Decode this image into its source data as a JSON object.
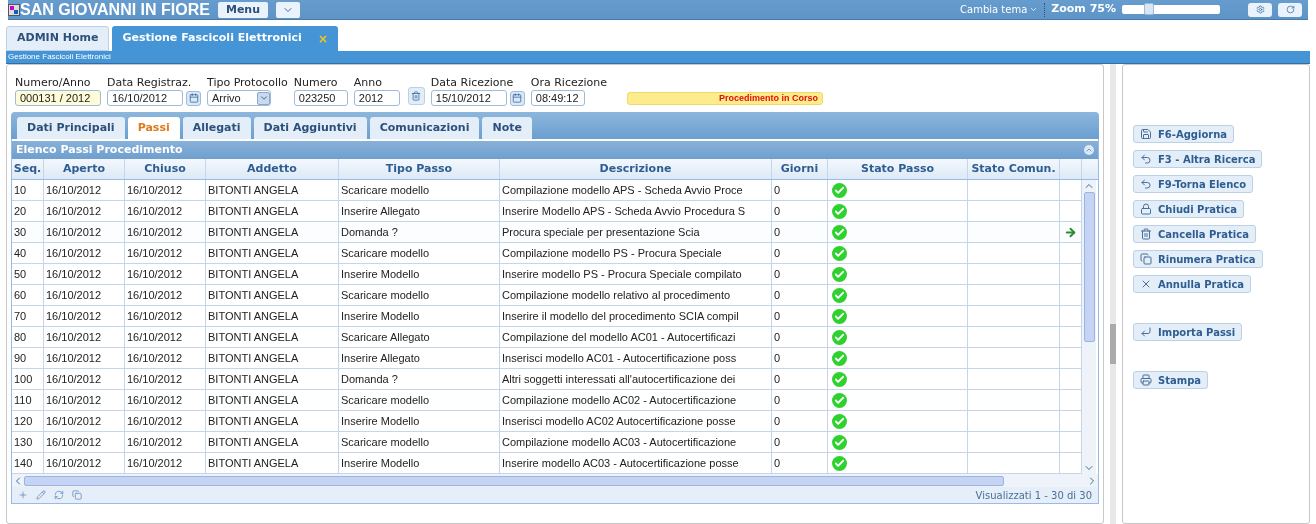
{
  "header": {
    "title": "SAN GIOVANNI IN FIORE",
    "menu_button": "Menu",
    "theme_menu": "Cambia tema",
    "zoom_label": "Zoom 75%",
    "zoom_slider": {
      "level": 0.28
    }
  },
  "main_tabs": [
    {
      "label": "ADMIN Home",
      "selected": false,
      "closable": false
    },
    {
      "label": "Gestione Fascicoli Elettronici",
      "selected": true,
      "closable": true,
      "close": "×"
    }
  ],
  "breadcrumb": "Gestione Fascicoli Elettronici",
  "fields": [
    {
      "label": "Numero/Anno",
      "value": "000131 / 2012",
      "kind": "highlight"
    },
    {
      "label": "Data Registraz.",
      "value": "16/10/2012",
      "kind": "date"
    },
    {
      "label": "Tipo Protocollo",
      "value": "Arrivo",
      "kind": "select"
    },
    {
      "label": "Numero",
      "value": "023250",
      "kind": "text"
    },
    {
      "label": "Anno",
      "value": "2012",
      "kind": "text-delete"
    },
    {
      "label": "Data Ricezione",
      "value": "15/10/2012",
      "kind": "date"
    },
    {
      "label": "Ora Ricezione",
      "value": "08:49:12",
      "kind": "text"
    }
  ],
  "status_badge": "Procedimento in Corso",
  "detail_tabs": [
    {
      "label": "Dati Principali",
      "selected": false
    },
    {
      "label": "Passi",
      "selected": true
    },
    {
      "label": "Allegati",
      "selected": false
    },
    {
      "label": "Dati Aggiuntivi",
      "selected": false
    },
    {
      "label": "Comunicazioni",
      "selected": false
    },
    {
      "label": "Note",
      "selected": false
    }
  ],
  "grid": {
    "title": "Elenco Passi Procedimento",
    "columns": [
      "Seq.",
      "Aperto",
      "Chiuso",
      "Addetto",
      "Tipo Passo",
      "Descrizione",
      "Giorni",
      "Stato Passo",
      "Stato Comun."
    ],
    "rows": [
      {
        "seq": "10",
        "aperto": "16/10/2012",
        "chiuso": "16/10/2012",
        "addetto": "BITONTI ANGELA",
        "tipo": "Scaricare modello",
        "descrizione": "Compilazione modello APS - Scheda Avvio Proce",
        "giorni": "0",
        "done": true,
        "current": false
      },
      {
        "seq": "20",
        "aperto": "16/10/2012",
        "chiuso": "16/10/2012",
        "addetto": "BITONTI ANGELA",
        "tipo": "Inserire Allegato",
        "descrizione": "Inserire Modello APS - Scheda Avvio Procedura S",
        "giorni": "0",
        "done": true,
        "current": false
      },
      {
        "seq": "30",
        "aperto": "16/10/2012",
        "chiuso": "16/10/2012",
        "addetto": "BITONTI ANGELA",
        "tipo": "Domanda ?",
        "descrizione": "Procura speciale per presentazione Scia",
        "giorni": "0",
        "done": true,
        "current": true
      },
      {
        "seq": "40",
        "aperto": "16/10/2012",
        "chiuso": "16/10/2012",
        "addetto": "BITONTI ANGELA",
        "tipo": "Scaricare modello",
        "descrizione": "Compilazione modello PS - Procura Speciale",
        "giorni": "0",
        "done": true,
        "current": false
      },
      {
        "seq": "50",
        "aperto": "16/10/2012",
        "chiuso": "16/10/2012",
        "addetto": "BITONTI ANGELA",
        "tipo": "Inserire Modello",
        "descrizione": "Inserire modello PS - Procura Speciale compilato",
        "giorni": "0",
        "done": true,
        "current": false
      },
      {
        "seq": "60",
        "aperto": "16/10/2012",
        "chiuso": "16/10/2012",
        "addetto": "BITONTI ANGELA",
        "tipo": "Scaricare modello",
        "descrizione": "Compilazione modello relativo al procedimento",
        "giorni": "0",
        "done": true,
        "current": false
      },
      {
        "seq": "70",
        "aperto": "16/10/2012",
        "chiuso": "16/10/2012",
        "addetto": "BITONTI ANGELA",
        "tipo": "Inserire Modello",
        "descrizione": "Inserire il modello del procedimento SCIA compil",
        "giorni": "0",
        "done": true,
        "current": false
      },
      {
        "seq": "80",
        "aperto": "16/10/2012",
        "chiuso": "16/10/2012",
        "addetto": "BITONTI ANGELA",
        "tipo": "Scaricare Allegato",
        "descrizione": "Compilazione del modello AC01 - Autocertificazi",
        "giorni": "0",
        "done": true,
        "current": false
      },
      {
        "seq": "90",
        "aperto": "16/10/2012",
        "chiuso": "16/10/2012",
        "addetto": "BITONTI ANGELA",
        "tipo": "Inserire Allegato",
        "descrizione": "Inserisci modello AC01 - Autocertificazione poss",
        "giorni": "0",
        "done": true,
        "current": false
      },
      {
        "seq": "100",
        "aperto": "16/10/2012",
        "chiuso": "16/10/2012",
        "addetto": "BITONTI ANGELA",
        "tipo": "Domanda ?",
        "descrizione": "Altri soggetti interessati all'autocertificazione dei",
        "giorni": "0",
        "done": true,
        "current": false
      },
      {
        "seq": "110",
        "aperto": "16/10/2012",
        "chiuso": "16/10/2012",
        "addetto": "BITONTI ANGELA",
        "tipo": "Scaricare modello",
        "descrizione": "Compilazione modello AC02 - Autocertificazione",
        "giorni": "0",
        "done": true,
        "current": false
      },
      {
        "seq": "120",
        "aperto": "16/10/2012",
        "chiuso": "16/10/2012",
        "addetto": "BITONTI ANGELA",
        "tipo": "Inserire Modello",
        "descrizione": "Inserisci modello AC02 Autocertificazione posse",
        "giorni": "0",
        "done": true,
        "current": false
      },
      {
        "seq": "130",
        "aperto": "16/10/2012",
        "chiuso": "16/10/2012",
        "addetto": "BITONTI ANGELA",
        "tipo": "Scaricare modello",
        "descrizione": "Compilazione modello AC03 - Autocertificazione",
        "giorni": "0",
        "done": true,
        "current": false
      },
      {
        "seq": "140",
        "aperto": "16/10/2012",
        "chiuso": "16/10/2012",
        "addetto": "BITONTI ANGELA",
        "tipo": "Inserire Modello",
        "descrizione": "Inserire modello AC03 - Autocertificazione posse",
        "giorni": "0",
        "done": true,
        "current": false
      }
    ],
    "pager": "Visualizzati 1 - 30 di 30"
  },
  "action_groups": [
    [
      {
        "label": "F6-Aggiorna",
        "kind": "save"
      },
      {
        "label": "F3 - Altra Ricerca",
        "kind": "back"
      },
      {
        "label": "F9-Torna Elenco",
        "kind": "back"
      },
      {
        "label": "Chiudi Pratica",
        "kind": "lock"
      },
      {
        "label": "Cancella Pratica",
        "kind": "delete"
      },
      {
        "label": "Rinumera Pratica",
        "kind": "copy"
      },
      {
        "label": "Annulla Pratica",
        "kind": "cancel"
      }
    ],
    [
      {
        "label": "Importa Passi",
        "kind": "import"
      }
    ],
    [
      {
        "label": "Stampa",
        "kind": "print"
      }
    ]
  ]
}
